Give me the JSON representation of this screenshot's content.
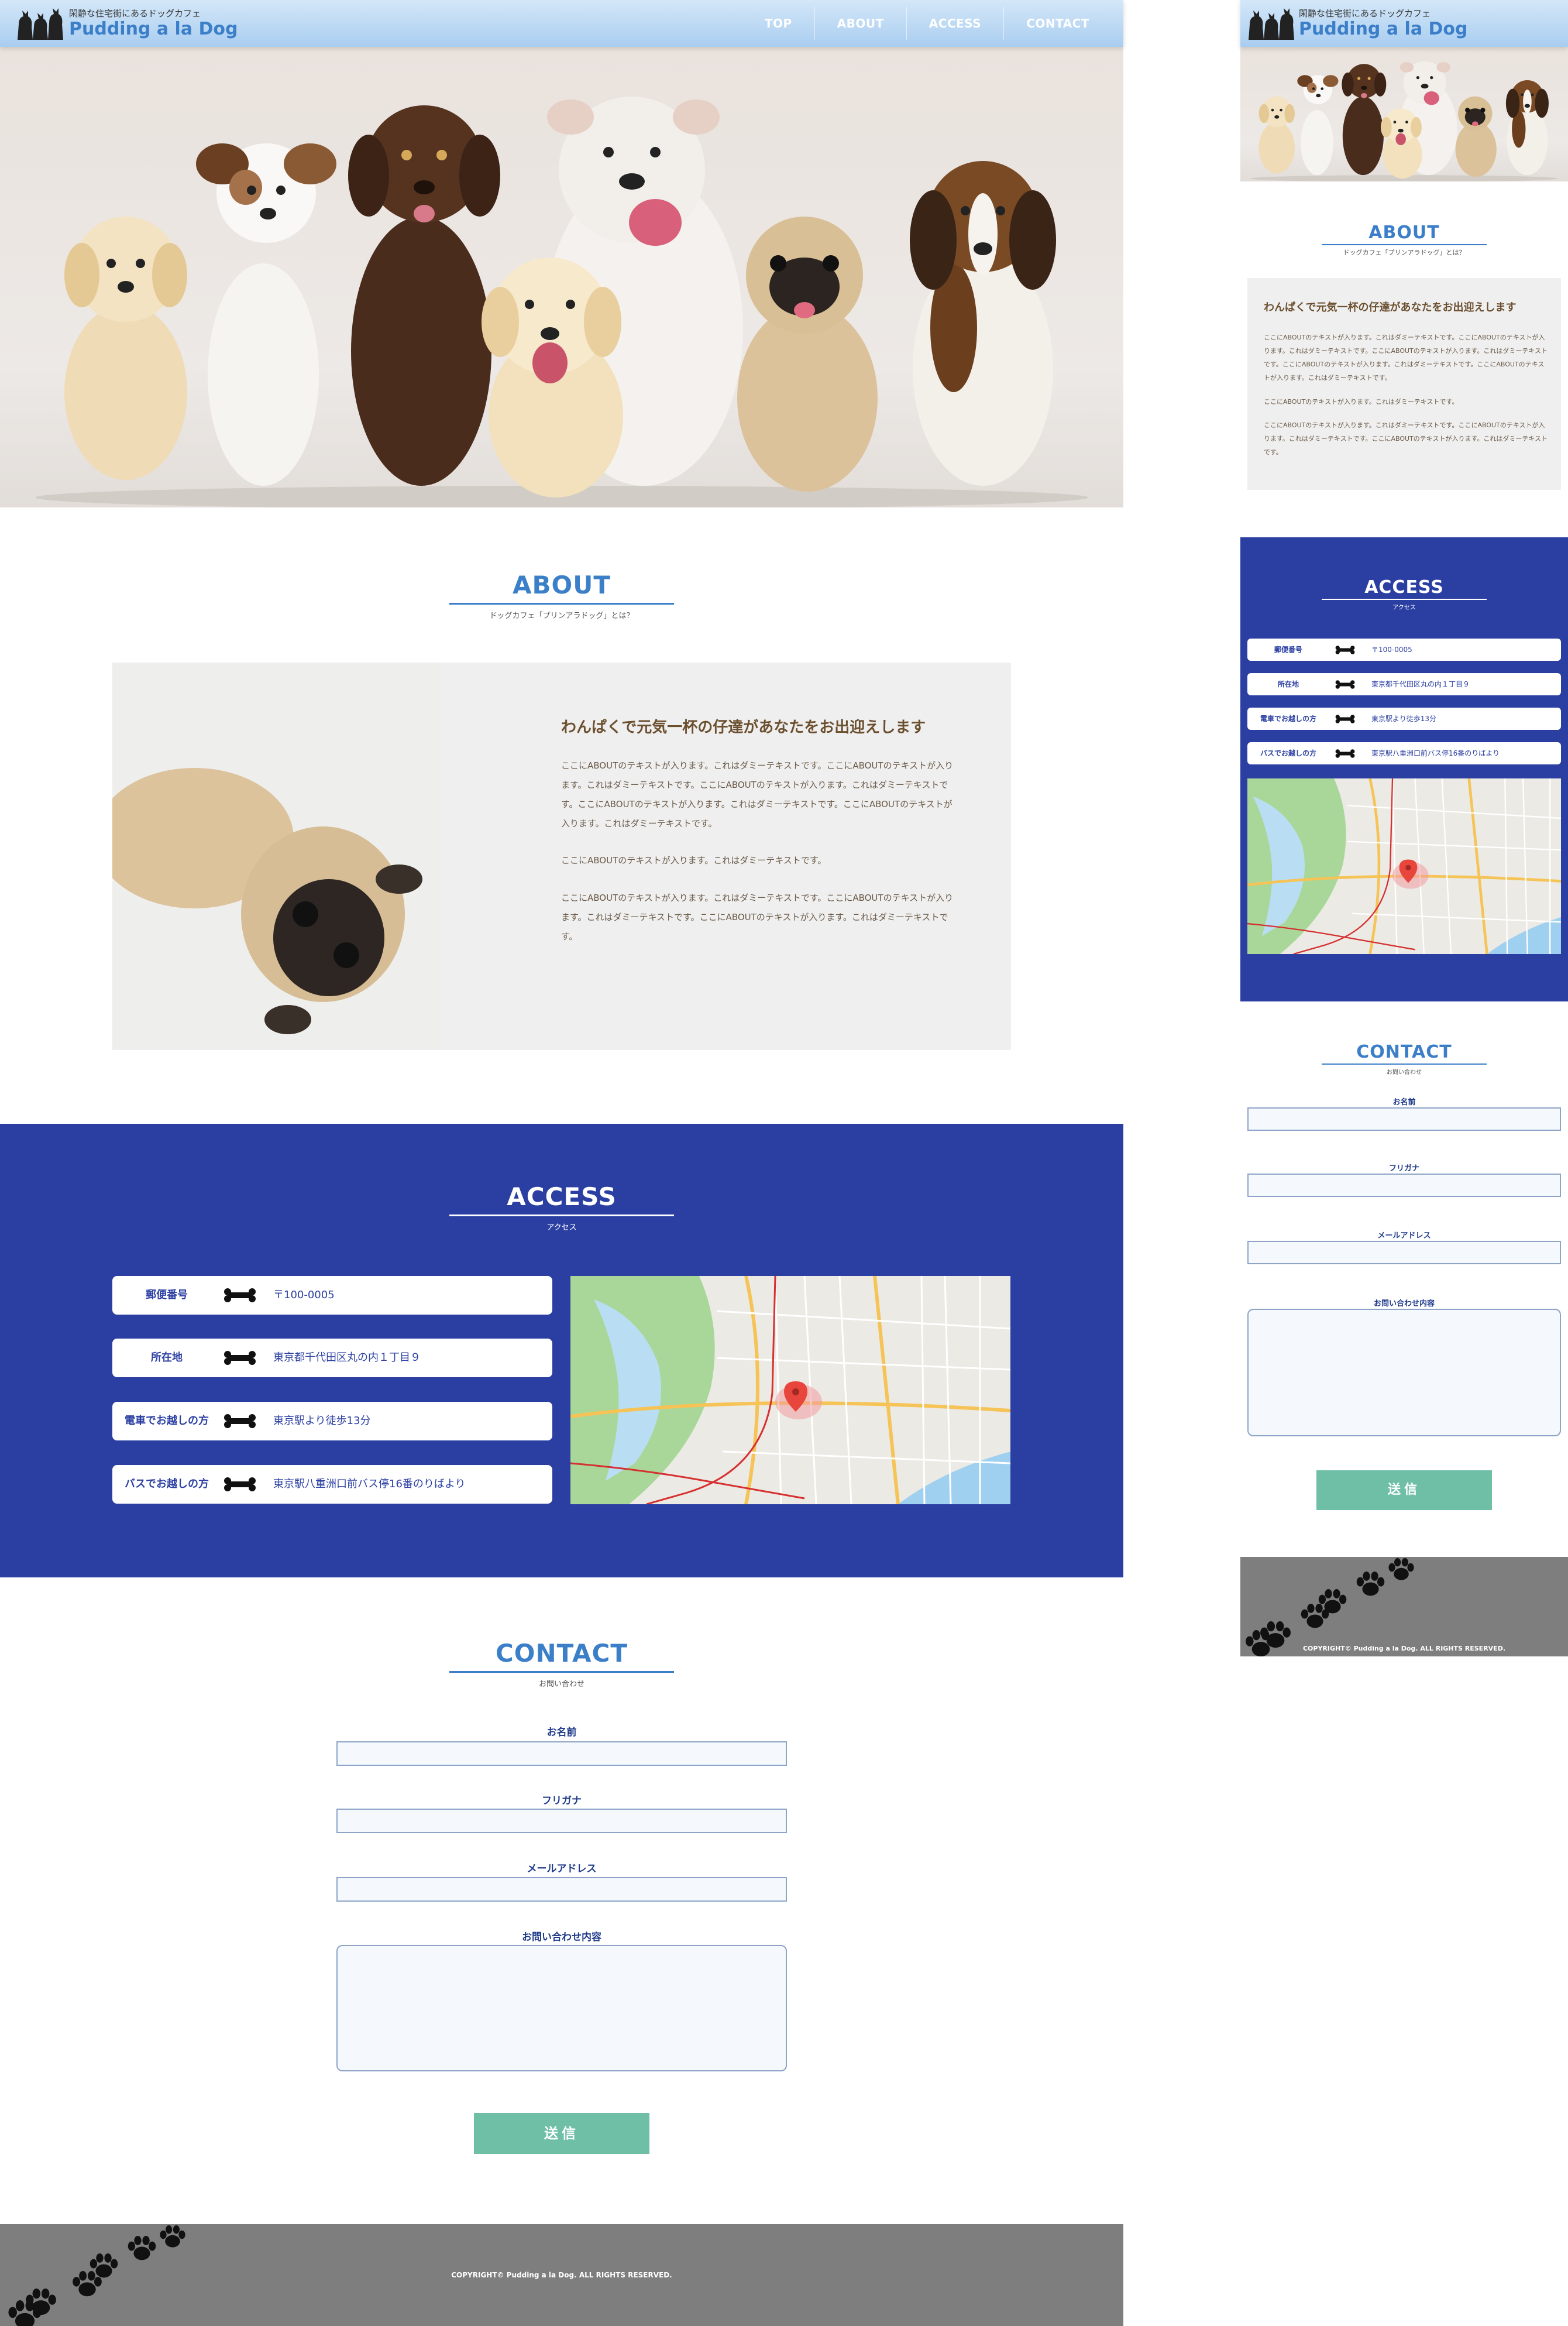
{
  "site": {
    "tagline": "閑静な住宅街にあるドッグカフェ",
    "brand": "Pudding a la Dog"
  },
  "nav": [
    "TOP",
    "ABOUT",
    "ACCESS",
    "CONTACT"
  ],
  "about": {
    "title": "ABOUT",
    "subtitle": "ドッグカフェ「プリンアラドッグ」とは？",
    "heading": "わんぱくで元気一杯の仔達があなたをお出迎えします",
    "paragraphs": [
      "ここにABOUTのテキストが入ります。これはダミーテキストです。ここにABOUTのテキストが入ります。これはダミーテキストです。ここにABOUTのテキストが入ります。これはダミーテキストです。ここにABOUTのテキストが入ります。これはダミーテキストです。ここにABOUTのテキストが入ります。これはダミーテキストです。",
      "ここにABOUTのテキストが入ります。これはダミーテキストです。",
      "ここにABOUTのテキストが入ります。これはダミーテキストです。ここにABOUTのテキストが入ります。これはダミーテキストです。ここにABOUTのテキストが入ります。これはダミーテキストです。"
    ]
  },
  "access": {
    "title": "ACCESS",
    "subtitle": "アクセス",
    "rows": [
      {
        "label": "郵便番号",
        "value": "〒100-0005"
      },
      {
        "label": "所在地",
        "value": "東京都千代田区丸の内１丁目９"
      },
      {
        "label": "電車でお越しの方",
        "value": "東京駅より徒歩13分"
      },
      {
        "label": "バスでお越しの方",
        "value": "東京駅八重洲口前バス停16番のりばより"
      }
    ]
  },
  "contact": {
    "title": "CONTACT",
    "subtitle": "お問い合わせ",
    "fields": [
      "お名前",
      "フリガナ",
      "メールアドレス",
      "お問い合わせ内容"
    ],
    "submit": "送信"
  },
  "footer": {
    "copyright": "COPYRIGHT© Pudding a la Dog. ALL RIGHTS RESERVED."
  },
  "colors": {
    "brand_blue": "#3c7fc9",
    "access_bg": "#2b3fa2",
    "submit_green": "#6fbfa7",
    "footer_gray": "#7e7e7e",
    "about_brown": "#6b4f2f"
  }
}
